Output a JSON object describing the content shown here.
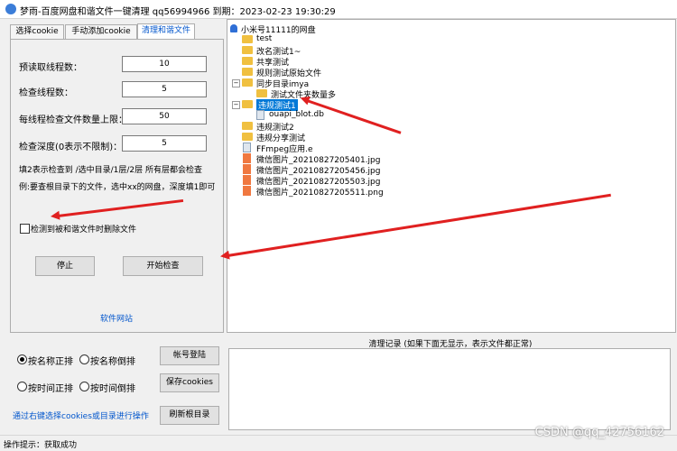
{
  "window": {
    "title": "梦雨-百度网盘和谐文件一键清理 qq56994966 到期：2023-02-23 19:30:29"
  },
  "tabs": [
    {
      "label": "选择cookie",
      "active": false
    },
    {
      "label": "手动添加cookie",
      "active": false
    },
    {
      "label": "清理和谐文件",
      "active": true
    }
  ],
  "settings": {
    "prefetch_threads_label": "预读取线程数：",
    "prefetch_threads_value": "10",
    "check_threads_label": "检查线程数：",
    "check_threads_value": "5",
    "per_thread_limit_label": "每线程检查文件数量上限：",
    "per_thread_limit_value": "50",
    "check_depth_label": "检查深度(0表示不限制)：",
    "check_depth_value": "5",
    "hint_line1": "填2表示检查到 /选中目录/1层/2层  所有层都会检查",
    "hint_line2": "例:要查根目录下的文件，选中xx的网盘，深度填1即可",
    "delete_checkbox_label": "检测到被和谐文件时删除文件",
    "stop_button": "停止",
    "start_button": "开始检查",
    "website_link": "软件网站"
  },
  "tree": {
    "root": "小米号11111的网盘",
    "items": [
      {
        "label": "test",
        "type": "folder"
      },
      {
        "label": "改名测试1~",
        "type": "folder"
      },
      {
        "label": "共享测试",
        "type": "folder"
      },
      {
        "label": "规则测试原始文件",
        "type": "folder"
      },
      {
        "label": "同步目录imya",
        "type": "folder"
      },
      {
        "label": "测试文件夹数量多",
        "type": "folder"
      },
      {
        "label": "违规测试1",
        "type": "folder",
        "selected": true
      },
      {
        "label": "ouapi_blot.db",
        "type": "file"
      },
      {
        "label": "违规测试2",
        "type": "folder"
      },
      {
        "label": "违规分享测试",
        "type": "folder"
      },
      {
        "label": "FFmpeg应用.e",
        "type": "file"
      },
      {
        "label": "微信图片_20210827205401.jpg",
        "type": "image"
      },
      {
        "label": "微信图片_20210827205456.jpg",
        "type": "image"
      },
      {
        "label": "微信图片_20210827205503.jpg",
        "type": "image"
      },
      {
        "label": "微信图片_20210827205511.png",
        "type": "image"
      }
    ]
  },
  "log": {
    "title": "清理记录  (如果下面无显示，表示文件都正常)"
  },
  "sort": {
    "by_name_asc": "按名称正排",
    "by_name_desc": "按名称倒排",
    "by_time_asc": "按时间正排",
    "by_time_desc": "按时间倒排",
    "selected": "by_name_asc"
  },
  "buttons": {
    "login": "帐号登陆",
    "save_cookies": "保存cookies",
    "refresh_root": "刷新根目录"
  },
  "hint_link": "通过右键选择cookies或目录进行操作",
  "status": {
    "text": "操作提示：获取成功"
  },
  "watermark": "CSDN @qq_42756162",
  "colors": {
    "accent": "#0055cc",
    "selection": "#0078d7",
    "arrow": "#e02020"
  }
}
